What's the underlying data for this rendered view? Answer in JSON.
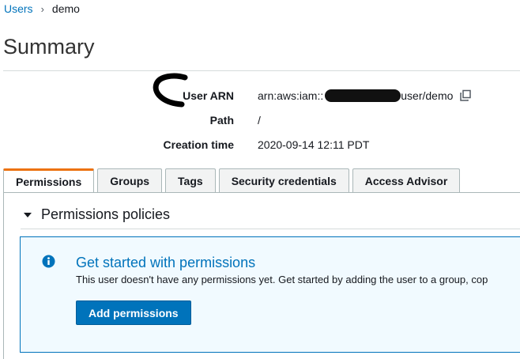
{
  "breadcrumb": {
    "parent": "Users",
    "separator": "›",
    "current": "demo"
  },
  "page": {
    "title": "Summary"
  },
  "summary": {
    "arn_label": "User ARN",
    "arn_prefix": "arn:aws:iam::",
    "arn_suffix": "user/demo",
    "path_label": "Path",
    "path_value": "/",
    "created_label": "Creation time",
    "created_value": "2020-09-14 12:11 PDT"
  },
  "tabs": [
    {
      "label": "Permissions",
      "active": true
    },
    {
      "label": "Groups",
      "active": false
    },
    {
      "label": "Tags",
      "active": false
    },
    {
      "label": "Security credentials",
      "active": false
    },
    {
      "label": "Access Advisor",
      "active": false
    }
  ],
  "permissions": {
    "section_title": "Permissions policies",
    "info_title": "Get started with permissions",
    "info_text": "This user doesn't have any permissions yet. Get started by adding the user to a group, cop",
    "button_label": "Add permissions"
  },
  "colors": {
    "accent": "#ec7211",
    "link": "#0073bb",
    "info_bg": "#f1faff"
  },
  "icons": {
    "copy": "copy-icon",
    "info": "info-icon",
    "caret": "caret-down-icon"
  }
}
